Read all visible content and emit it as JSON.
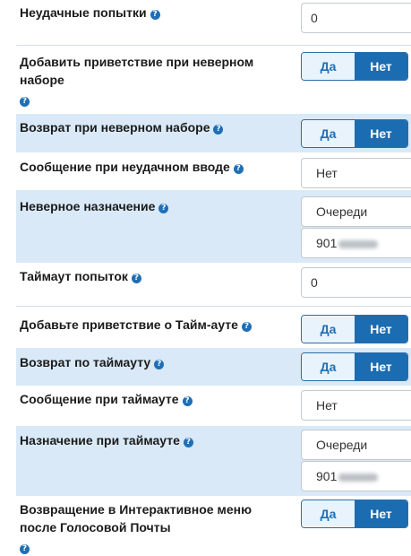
{
  "help_glyph": "?",
  "rows": {
    "fail_attempts": {
      "label": "Неудачные попытки",
      "value": "0"
    },
    "add_greeting_wrong": {
      "label_line1": "Добавить приветствие при неверном",
      "label_line2": "наборе",
      "yes": "Да",
      "no": "Нет",
      "selected": "Нет"
    },
    "return_wrong": {
      "label": "Возврат при неверном наборе",
      "yes": "Да",
      "no": "Нет",
      "selected": "Нет"
    },
    "msg_fail_input": {
      "label": "Сообщение при неудачном вводе",
      "value": "Нет"
    },
    "wrong_destination": {
      "label": "Неверное назначение",
      "category": "Очереди",
      "target": "901"
    },
    "timeout_attempts": {
      "label": "Таймаут попыток",
      "value": "0"
    },
    "add_greeting_timeout": {
      "label": "Добавьте приветствие о Тайм-ауте",
      "yes": "Да",
      "no": "Нет",
      "selected": "Нет"
    },
    "return_timeout": {
      "label": "Возврат по таймауту",
      "yes": "Да",
      "no": "Нет",
      "selected": "Нет"
    },
    "msg_timeout": {
      "label": "Сообщение при таймауте",
      "value": "Нет"
    },
    "timeout_destination": {
      "label": "Назначение при таймауте",
      "category": "Очереди",
      "target": "901"
    },
    "return_ivr_voicemail": {
      "label_line1": "Возвращение в Интерактивное меню",
      "label_line2": "после Голосовой Почты",
      "yes": "Да",
      "no": "Нет",
      "selected": "Нет"
    }
  }
}
